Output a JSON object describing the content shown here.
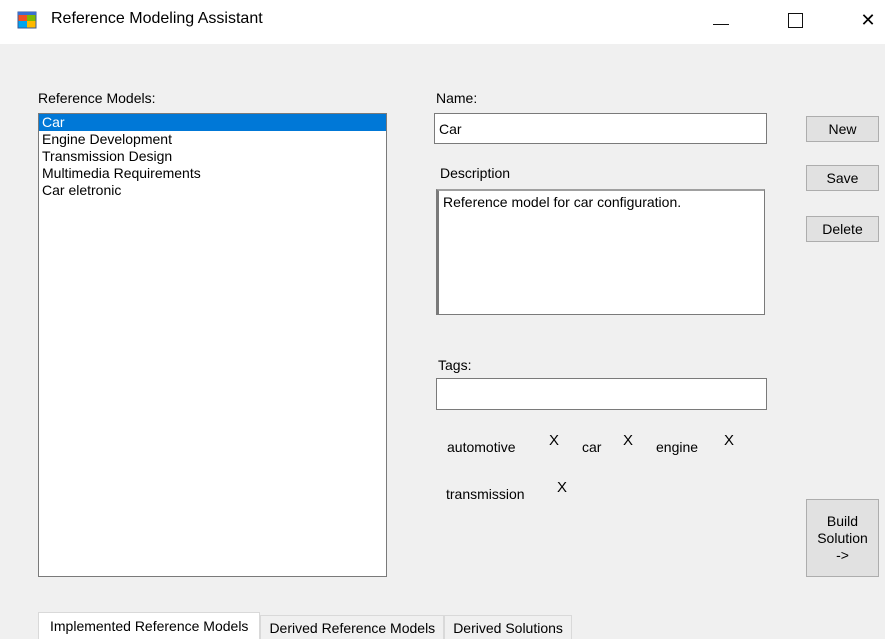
{
  "window": {
    "title": "Reference Modeling Assistant",
    "controls": {
      "minimize": "—",
      "close": "✕"
    }
  },
  "left": {
    "label": "Reference Models:",
    "items": [
      {
        "label": "Car",
        "selected": true
      },
      {
        "label": "Engine Development",
        "selected": false
      },
      {
        "label": "Transmission Design",
        "selected": false
      },
      {
        "label": "Multimedia Requirements",
        "selected": false
      },
      {
        "label": "Car eletronic",
        "selected": false
      }
    ]
  },
  "form": {
    "name_label": "Name:",
    "name_value": "Car",
    "description_label": "Description",
    "description_value": "Reference model for car configuration.",
    "tags_label": "Tags:",
    "tags_value": "",
    "tags": [
      {
        "label": "automotive",
        "remove": "X"
      },
      {
        "label": "car",
        "remove": "X"
      },
      {
        "label": "engine",
        "remove": "X"
      },
      {
        "label": "transmission",
        "remove": "X"
      }
    ]
  },
  "buttons": {
    "new": "New",
    "save": "Save",
    "delete": "Delete",
    "build_line1": "Build",
    "build_line2": "Solution",
    "build_line3": "->"
  },
  "tabs": [
    {
      "label": "Implemented Reference Models",
      "active": true
    },
    {
      "label": "Derived Reference Models",
      "active": false
    },
    {
      "label": "Derived Solutions",
      "active": false
    }
  ],
  "colors": {
    "selection": "#0078d7",
    "window_bg": "#f0f0f0",
    "button_bg": "#e1e1e1"
  }
}
